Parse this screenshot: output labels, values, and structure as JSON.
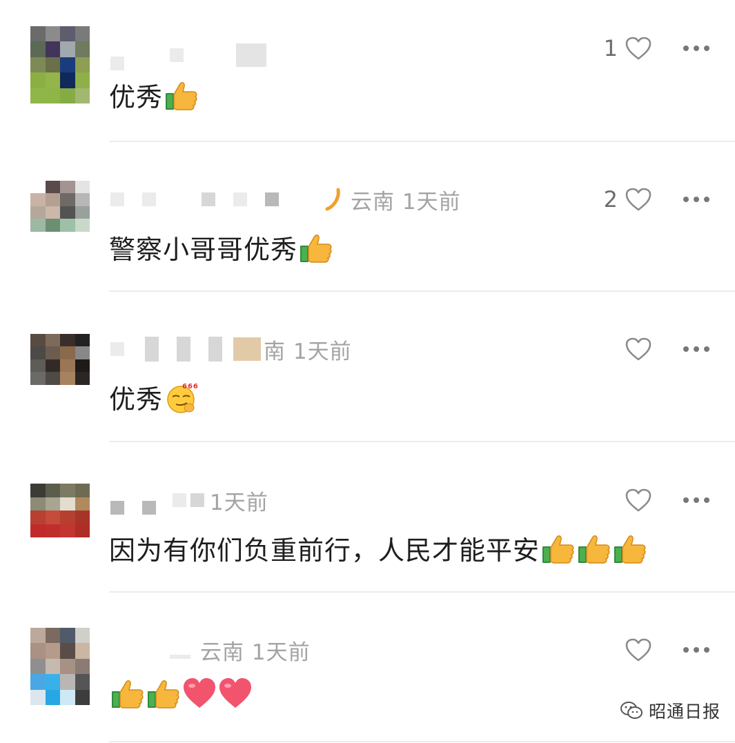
{
  "comments": [
    {
      "location_time": "",
      "likes": "1",
      "text": "优秀",
      "emojis": [
        "thumbs-up-icon"
      ]
    },
    {
      "location_time": "云南 1天前",
      "likes": "2",
      "text": "警察小哥哥优秀",
      "emojis": [
        "thumbs-up-icon"
      ]
    },
    {
      "location_time": "南 1天前",
      "likes": "",
      "text": "优秀",
      "emojis": [
        "666-smirk-emoji-icon"
      ]
    },
    {
      "location_time": "1天前",
      "likes": "",
      "text": "因为有你们负重前行，人民才能平安",
      "emojis": [
        "thumbs-up-icon",
        "thumbs-up-icon",
        "thumbs-up-icon"
      ]
    },
    {
      "location_time": "云南 1天前",
      "likes": "",
      "text": "",
      "emojis": [
        "thumbs-up-icon",
        "thumbs-up-icon",
        "heart-emoji-icon",
        "heart-emoji-icon"
      ]
    }
  ],
  "watermark": {
    "label": "昭通日报",
    "icon": "wechat-icon"
  },
  "colors": {
    "meta_text": "#a3a3a3",
    "like_icon": "#8a8a8a",
    "divider": "#ececec"
  }
}
